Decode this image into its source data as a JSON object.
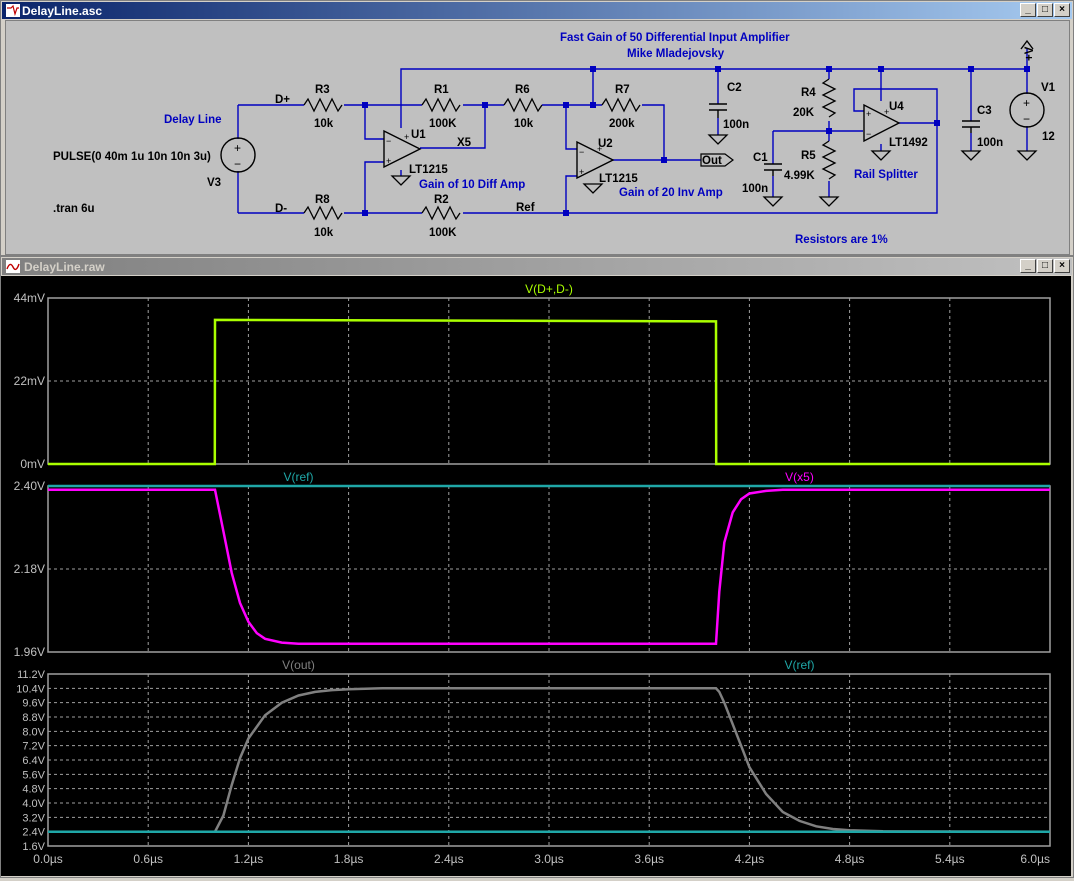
{
  "schematic_window": {
    "title": "DelayLine.asc"
  },
  "plot_window": {
    "title": "DelayLine.raw"
  },
  "window_buttons": {
    "minimize": "_",
    "maximize": "□",
    "close": "×"
  },
  "colors": {
    "wire": "#0000c0",
    "schem_bg": "#c0c0c0",
    "plot_bg": "#000000",
    "grid": "#a0a0a0",
    "trace_d": "#aaff00",
    "trace_x5": "#ff00ff",
    "trace_ref": "#1fa7a7",
    "trace_out": "#808080",
    "axis_text": "#c0c0c0"
  },
  "schematic": {
    "title_line1": "Fast Gain of 50 Differential Input Amplifier",
    "title_line2": "Mike Mladejovsky",
    "delay_line": "Delay Line",
    "pulse": "PULSE(0 40m 1u 10n 10n 3u)",
    "v3": "V3",
    "tran": ".tran 6u",
    "dplus": "D+",
    "dminus": "D-",
    "r3": "R3",
    "r3v": "10k",
    "r8": "R8",
    "r8v": "10k",
    "r1": "R1",
    "r1v": "100K",
    "r2": "R2",
    "r2v": "100K",
    "r6": "R6",
    "r6v": "10k",
    "r7": "R7",
    "r7v": "200k",
    "u1": "U1",
    "u1p": "LT1215",
    "u2": "U2",
    "u2p": "LT1215",
    "u4": "U4",
    "u4p": "LT1492",
    "x5": "X5",
    "ref": "Ref",
    "out": "Out",
    "gain10": "Gain of 10 Diff Amp",
    "gain20": "Gain of 20 Inv Amp",
    "c2": "C2",
    "c2v": "100n",
    "c1": "C1",
    "c1v": "100n",
    "c3": "C3",
    "c3v": "100n",
    "r4": "R4",
    "r4v": "20K",
    "r5": "R5",
    "r5v": "4.99K",
    "rail": "Rail Splitter",
    "resistors": "Resistors are 1%",
    "vplus": "+V",
    "v1": "V1",
    "v1v": "12",
    "plus": "+",
    "minus": "−"
  },
  "chart_data": [
    {
      "type": "line",
      "series": [
        {
          "name": "V(D+,D-)",
          "x": [
            0,
            0.999,
            1.0,
            4.0,
            4.001,
            6.0
          ],
          "y": [
            0,
            0,
            38.2,
            37.8,
            0,
            0
          ]
        }
      ],
      "ylim": [
        0,
        44
      ],
      "yticks": [
        "44mV",
        "22mV",
        "0mV"
      ],
      "xlim": [
        0,
        6
      ]
    },
    {
      "type": "line",
      "series": [
        {
          "name": "V(ref)",
          "x": [
            0,
            6.0
          ],
          "y": [
            2.4,
            2.4
          ]
        },
        {
          "name": "V(x5)",
          "x": [
            0,
            1.0,
            1.05,
            1.1,
            1.15,
            1.2,
            1.25,
            1.3,
            1.4,
            1.5,
            1.7,
            2.0,
            4.0,
            4.02,
            4.05,
            4.1,
            4.15,
            4.2,
            4.3,
            4.4,
            4.6,
            6.0
          ],
          "y": [
            2.39,
            2.39,
            2.28,
            2.17,
            2.09,
            2.04,
            2.01,
            1.995,
            1.985,
            1.982,
            1.982,
            1.982,
            1.982,
            2.12,
            2.25,
            2.33,
            2.365,
            2.38,
            2.387,
            2.39,
            2.39,
            2.39
          ]
        }
      ],
      "ylim": [
        1.96,
        2.4
      ],
      "yticks": [
        "2.40V",
        "2.18V",
        "1.96V"
      ],
      "xlim": [
        0,
        6
      ]
    },
    {
      "type": "line",
      "series": [
        {
          "name": "V(out)",
          "x": [
            0,
            1.0,
            1.05,
            1.1,
            1.15,
            1.2,
            1.3,
            1.4,
            1.5,
            1.6,
            1.7,
            1.8,
            2.0,
            2.4,
            3.0,
            3.6,
            4.0,
            4.02,
            4.05,
            4.1,
            4.15,
            4.2,
            4.3,
            4.4,
            4.5,
            4.6,
            4.7,
            4.8,
            5.0,
            6.0
          ],
          "y": [
            2.4,
            2.4,
            3.3,
            5.0,
            6.5,
            7.6,
            8.9,
            9.6,
            10.0,
            10.2,
            10.3,
            10.35,
            10.4,
            10.4,
            10.4,
            10.4,
            10.4,
            10.2,
            9.6,
            8.4,
            7.2,
            6.0,
            4.5,
            3.5,
            3.0,
            2.7,
            2.55,
            2.48,
            2.42,
            2.4
          ]
        },
        {
          "name": "V(ref)",
          "x": [
            0,
            6.0
          ],
          "y": [
            2.4,
            2.4
          ]
        }
      ],
      "ylim": [
        1.6,
        11.2
      ],
      "yticks": [
        "11.2V",
        "10.4V",
        "9.6V",
        "8.8V",
        "8.0V",
        "7.2V",
        "6.4V",
        "5.6V",
        "4.8V",
        "4.0V",
        "3.2V",
        "2.4V",
        "1.6V"
      ],
      "xlim": [
        0,
        6
      ],
      "xticks": [
        "0.0µs",
        "0.6µs",
        "1.2µs",
        "1.8µs",
        "2.4µs",
        "3.0µs",
        "3.6µs",
        "4.2µs",
        "4.8µs",
        "5.4µs",
        "6.0µs"
      ]
    }
  ]
}
